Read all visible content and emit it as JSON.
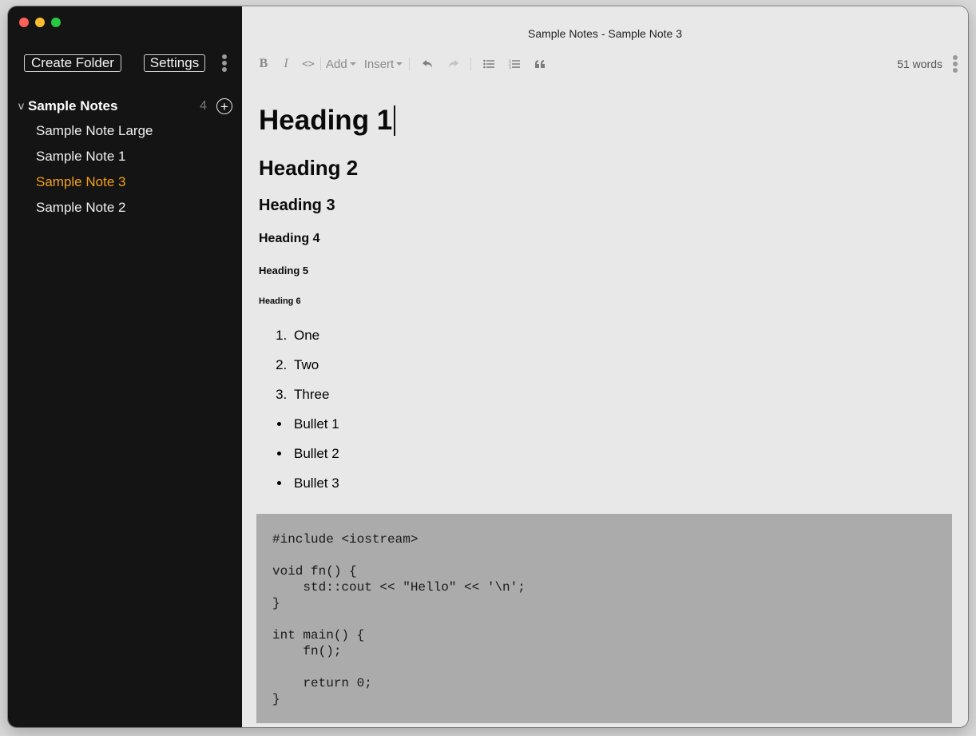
{
  "window": {
    "title": "Sample Notes - Sample Note 3"
  },
  "sidebar": {
    "create_folder_label": "Create Folder",
    "settings_label": "Settings",
    "folder": {
      "name": "Sample Notes",
      "count": "4",
      "expanded_indicator": "v"
    },
    "notes": [
      {
        "label": "Sample Note Large",
        "active": false
      },
      {
        "label": "Sample Note 1",
        "active": false
      },
      {
        "label": "Sample Note 3",
        "active": true
      },
      {
        "label": "Sample Note 2",
        "active": false
      }
    ],
    "accent_color": "#f5a01a"
  },
  "toolbar": {
    "bold_label": "B",
    "italic_label": "I",
    "code_label": "<>",
    "add_label": "Add",
    "insert_label": "Insert",
    "word_count": "51 words"
  },
  "editor": {
    "headings": [
      "Heading 1",
      "Heading 2",
      "Heading 3",
      "Heading 4",
      "Heading 5",
      "Heading 6"
    ],
    "ordered_items": [
      "One",
      "Two",
      "Three"
    ],
    "bullet_items": [
      "Bullet 1",
      "Bullet 2",
      "Bullet 3"
    ],
    "code": "#include <iostream>\n\nvoid fn() {\n    std::cout << \"Hello\" << '\\n';\n}\n\nint main() {\n    fn();\n\n    return 0;\n}"
  }
}
